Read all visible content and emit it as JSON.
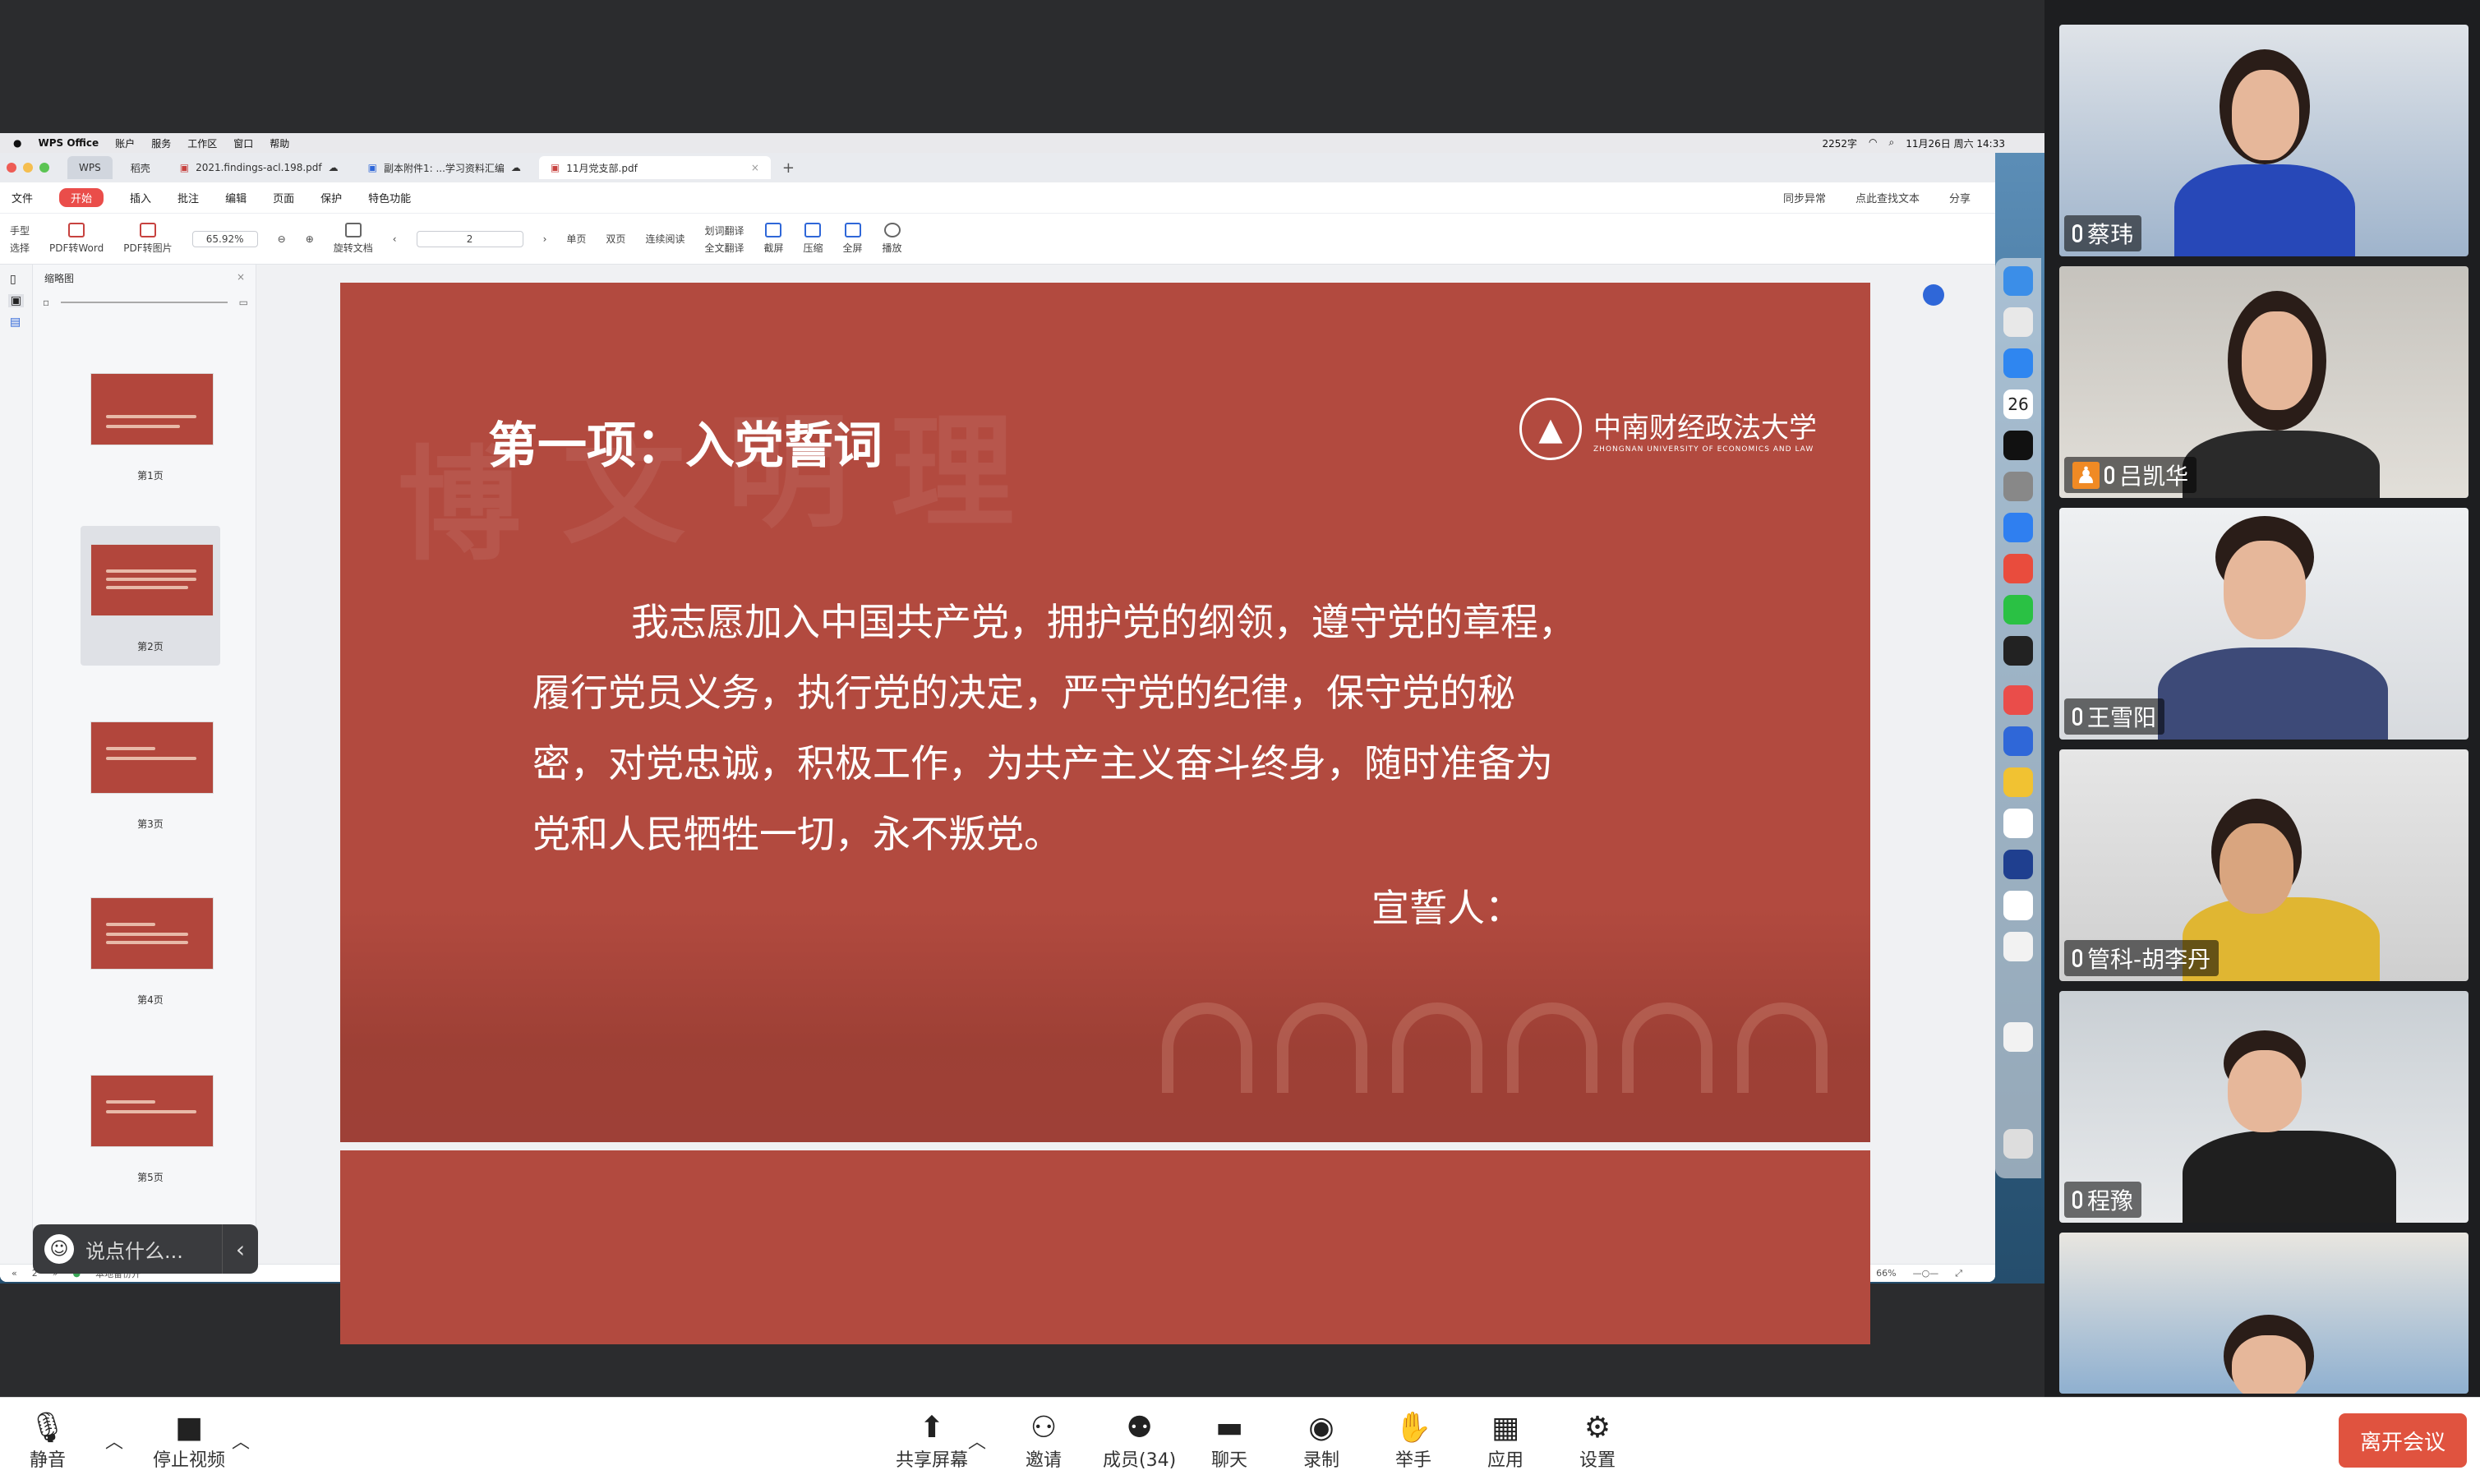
{
  "menubar": {
    "apple": "",
    "app": "WPS Office",
    "items": [
      "账户",
      "服务",
      "工作区",
      "窗口",
      "帮助"
    ],
    "right": {
      "chars": "2252字",
      "datetime": "11月26日 周六 14:33"
    }
  },
  "tabs": [
    {
      "label": "WPS"
    },
    {
      "label": "稻壳"
    },
    {
      "label": "2021.findings-acl.198.pdf"
    },
    {
      "label": "副本附件1: ...学习资料汇编"
    },
    {
      "label": "11月党支部.pdf"
    }
  ],
  "menus": {
    "file": "文件",
    "start": "开始",
    "items": [
      "插入",
      "批注",
      "编辑",
      "页面",
      "保护",
      "特色功能"
    ],
    "right": [
      "同步异常",
      "点此查找文本",
      "分享"
    ]
  },
  "toolbar": {
    "hand": "手型",
    "select": "选择",
    "pdf_word": "PDF转Word",
    "pdf_img": "PDF转图片",
    "zoom": "65.92%",
    "rotate": "旋转文档",
    "page": "2",
    "single": "单页",
    "double": "双页",
    "continuous": "连续阅读",
    "word_translate": "划词翻译",
    "full_translate": "全文翻译",
    "screenshot": "截屏",
    "compress": "压缩",
    "fullscreen": "全屏",
    "play": "播放"
  },
  "thumbs": {
    "title": "缩略图",
    "pages": [
      "第1页",
      "第2页",
      "第3页",
      "第4页",
      "第5页"
    ]
  },
  "slide": {
    "title": "第一项：入党誓词",
    "watermark": [
      "博",
      "文",
      "明",
      "理"
    ],
    "logo": {
      "cn": "中南财经政法大学",
      "en": "ZHONGNAN UNIVERSITY OF ECONOMICS AND LAW"
    },
    "oath_lines": [
      "我志愿加入中国共产党，拥护党的纲领，遵守党的章程，",
      "履行党员义务，执行党的决定，严守党的纪律，保守党的秘",
      "密，对党忠诚，积极工作，为共产主义奋斗终身，随时准备为",
      "党和人民牺牲一切，永不叛党。"
    ],
    "signer": "宣誓人："
  },
  "statusbar": {
    "page": "2",
    "backup": "本地备份开",
    "zoom": "66%"
  },
  "chat_input": {
    "placeholder": "说点什么..."
  },
  "dock_date": "26",
  "participants": [
    {
      "name": "蔡玮"
    },
    {
      "name": "吕凯华"
    },
    {
      "name": "王雪阳"
    },
    {
      "name": "管科-胡李丹"
    },
    {
      "name": "程豫"
    },
    {
      "name": ""
    }
  ],
  "zoom_bar": {
    "mute": "静音",
    "stop_video": "停止视频",
    "share": "共享屏幕",
    "invite": "邀请",
    "members": "成员(34)",
    "chat": "聊天",
    "record": "录制",
    "raise_hand": "举手",
    "apps": "应用",
    "settings": "设置",
    "leave": "离开会议"
  },
  "colors": {
    "slide_bg": "#b24a3f",
    "wps_accent": "#ea4d4a",
    "leave": "#e0533f"
  }
}
